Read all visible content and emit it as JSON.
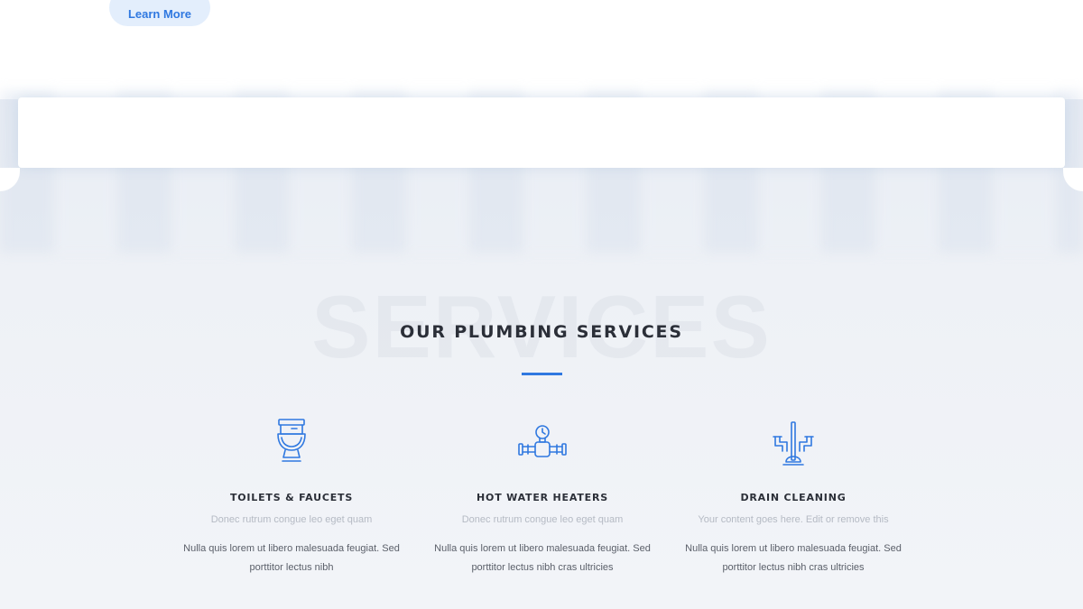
{
  "hero": {
    "learn_more_label": "Learn More"
  },
  "services_section": {
    "background_word": "SERVICES",
    "title": "OUR PLUMBING SERVICES",
    "accent_color": "#2f78e0",
    "items": [
      {
        "icon": "toilet-icon",
        "name": "TOILETS & FAUCETS",
        "subtitle": "Donec rutrum congue leo eget quam",
        "description": "Nulla quis lorem ut libero malesuada feugiat. Sed porttitor lectus nibh"
      },
      {
        "icon": "water-heater-pipe-icon",
        "name": "HOT WATER HEATERS",
        "subtitle": "Donec rutrum congue leo eget quam",
        "description": "Nulla quis lorem ut libero malesuada feugiat. Sed porttitor lectus nibh cras ultricies"
      },
      {
        "icon": "plunger-icon",
        "name": "DRAIN CLEANING",
        "subtitle": "Your content goes here. Edit or remove this",
        "description": "Nulla quis lorem ut libero malesuada feugiat. Sed porttitor lectus nibh cras ultricies"
      }
    ]
  }
}
